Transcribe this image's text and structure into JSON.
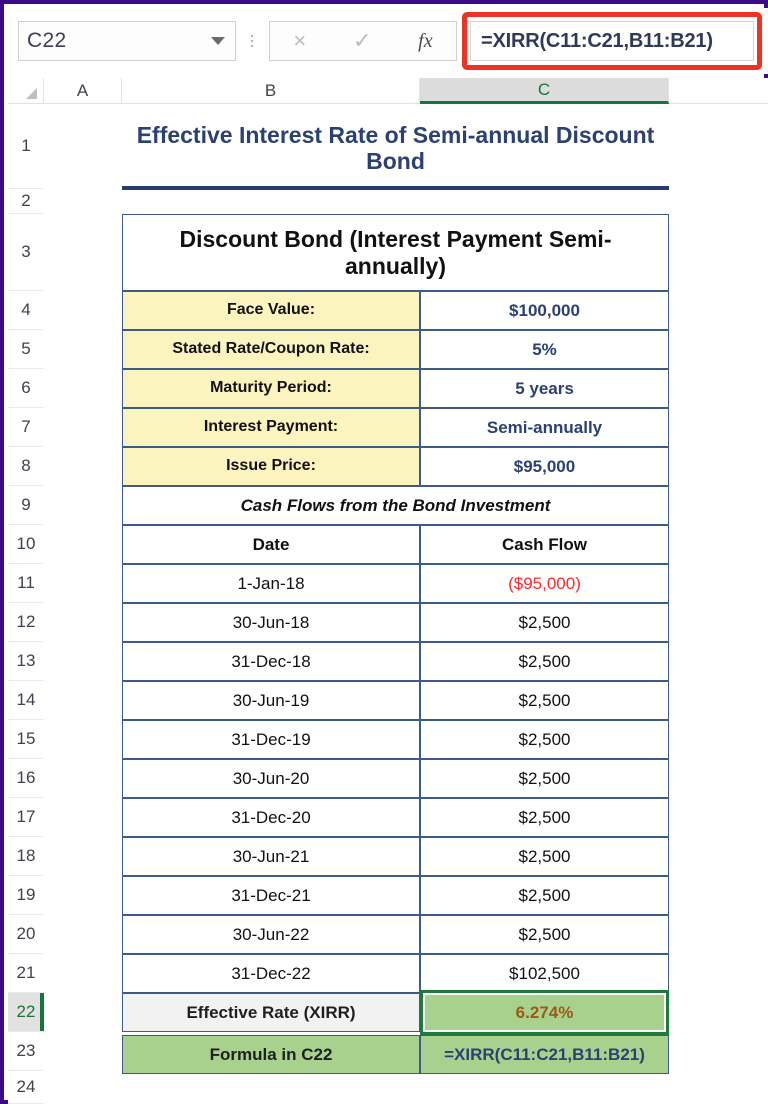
{
  "app": {
    "name": "excel-spreadsheet",
    "accent_green": "#17753a",
    "highlight_red": "#ee3224",
    "label_yellow": "#fcf4bf",
    "result_green": "#a9d18e",
    "title_blue": "#2b4172"
  },
  "formula_bar": {
    "name_box_value": "C22",
    "name_box_placeholder": "Name Box",
    "cancel_icon": "close-icon",
    "confirm_icon": "check-icon",
    "insert_function_icon": "fx-icon",
    "fx_label": "fx",
    "cancel_label": "×",
    "confirm_label": "✓",
    "formula_value": "=XIRR(C11:C21,B11:B21)",
    "formula_placeholder": "Enter formula"
  },
  "columns": {
    "corner": "",
    "headers": [
      "A",
      "B",
      "C"
    ],
    "selected": "C"
  },
  "rows": {
    "numbers": [
      "1",
      "2",
      "3",
      "4",
      "5",
      "6",
      "7",
      "8",
      "9",
      "10",
      "11",
      "12",
      "13",
      "14",
      "15",
      "16",
      "17",
      "18",
      "19",
      "20",
      "21",
      "22",
      "23",
      "24"
    ],
    "selected": "22"
  },
  "sheet": {
    "title": "Effective Interest Rate of Semi-annual Discount Bond",
    "table_header": "Discount Bond (Interest Payment Semi-annually)",
    "parameters": [
      {
        "label": "Face Value:",
        "value": "$100,000"
      },
      {
        "label": "Stated Rate/Coupon Rate:",
        "value": "5%"
      },
      {
        "label": "Maturity Period:",
        "value": "5 years"
      },
      {
        "label": "Interest Payment:",
        "value": "Semi-annually"
      },
      {
        "label": "Issue Price:",
        "value": "$95,000"
      }
    ],
    "cashflow_section_title": "Cash Flows from the Bond Investment",
    "cashflow_columns": {
      "date": "Date",
      "cash_flow": "Cash Flow"
    },
    "cashflows": [
      {
        "date": "1-Jan-18",
        "amount": "($95,000)",
        "negative": true
      },
      {
        "date": "30-Jun-18",
        "amount": "$2,500",
        "negative": false
      },
      {
        "date": "31-Dec-18",
        "amount": "$2,500",
        "negative": false
      },
      {
        "date": "30-Jun-19",
        "amount": "$2,500",
        "negative": false
      },
      {
        "date": "31-Dec-19",
        "amount": "$2,500",
        "negative": false
      },
      {
        "date": "30-Jun-20",
        "amount": "$2,500",
        "negative": false
      },
      {
        "date": "31-Dec-20",
        "amount": "$2,500",
        "negative": false
      },
      {
        "date": "30-Jun-21",
        "amount": "$2,500",
        "negative": false
      },
      {
        "date": "31-Dec-21",
        "amount": "$2,500",
        "negative": false
      },
      {
        "date": "30-Jun-22",
        "amount": "$2,500",
        "negative": false
      },
      {
        "date": "31-Dec-22",
        "amount": "$102,500",
        "negative": false
      }
    ],
    "result": {
      "label": "Effective Rate (XIRR)",
      "value": "6.274%"
    },
    "formula_row": {
      "label": "Formula in C22",
      "value": "=XIRR(C11:C21,B11:B21)"
    }
  }
}
